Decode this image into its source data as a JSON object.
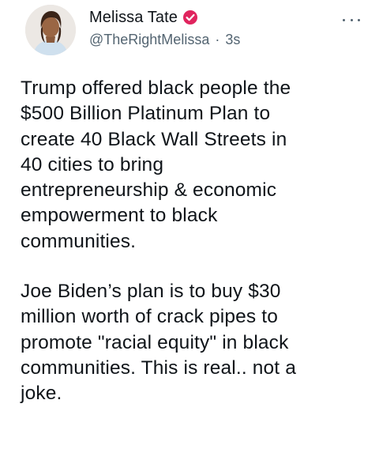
{
  "author": {
    "display_name": "Melissa Tate",
    "handle": "@TheRightMelissa",
    "separator": "·",
    "timestamp": "3s",
    "verified": true,
    "verified_color": "#e0245e",
    "avatar_icon": "profile-photo"
  },
  "menu": {
    "icon": "more-options-icon"
  },
  "tweet": {
    "paragraph_1": "Trump offered black people the\n$500 Billion Platinum Plan to\ncreate 40 Black Wall Streets in\n40 cities to bring\nentrepreneurship & economic\nempowerment to black\ncommunities.",
    "paragraph_2": "Joe Biden’s plan is to buy $30\nmillion worth of crack pipes to\npromote \"racial equity\" in black\ncommunities. This is real.. not a\njoke."
  },
  "colors": {
    "text_primary": "#0f1419",
    "text_secondary": "#536471",
    "background": "#ffffff"
  }
}
